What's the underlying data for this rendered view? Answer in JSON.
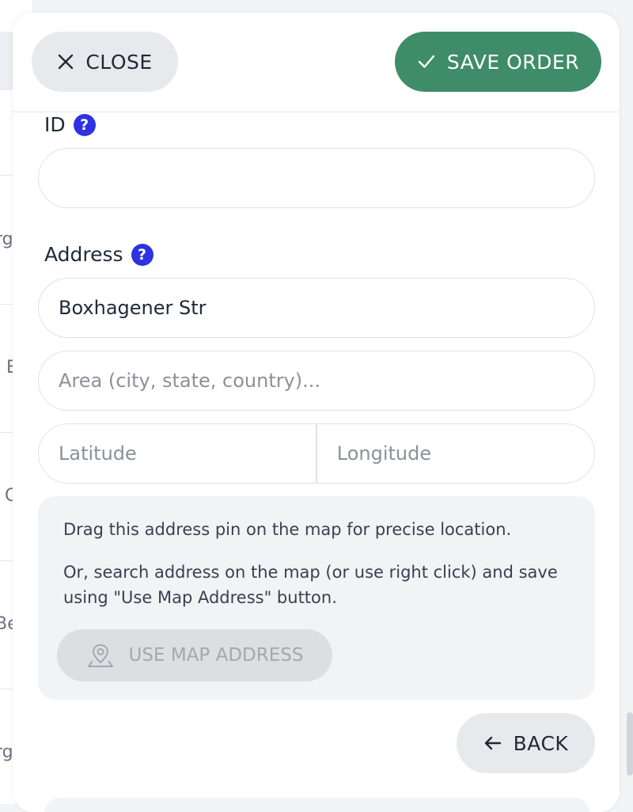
{
  "toolbar": {
    "close_label": "CLOSE",
    "save_label": "SAVE ORDER"
  },
  "form": {
    "id": {
      "label": "ID",
      "help": "?",
      "value": ""
    },
    "address": {
      "label": "Address",
      "help": "?",
      "street_value": "Boxhagener Str",
      "area_placeholder": "Area (city, state, country)...",
      "latitude_placeholder": "Latitude",
      "longitude_placeholder": "Longitude"
    }
  },
  "info": {
    "line1": "Drag this address pin on the map for precise location.",
    "line2": "Or, search address on the map (or use right click) and save using \"Use Map Address\" button.",
    "map_button_label": "USE MAP ADDRESS"
  },
  "footer": {
    "back_label": "BACK"
  },
  "background_list": {
    "fragments": [
      "rg",
      "E",
      "C",
      "Be",
      "rg"
    ]
  },
  "colors": {
    "save": "#3f8d68",
    "help": "#2d33e0",
    "neutral_button": "#e8e9ec",
    "disabled_button": "#dcdee2",
    "info_bg": "#f2f3f5"
  },
  "icons": {
    "close": "x-icon",
    "save": "check-icon",
    "map": "map-pin-icon",
    "back": "arrow-left-icon",
    "help": "question-circle-icon"
  }
}
